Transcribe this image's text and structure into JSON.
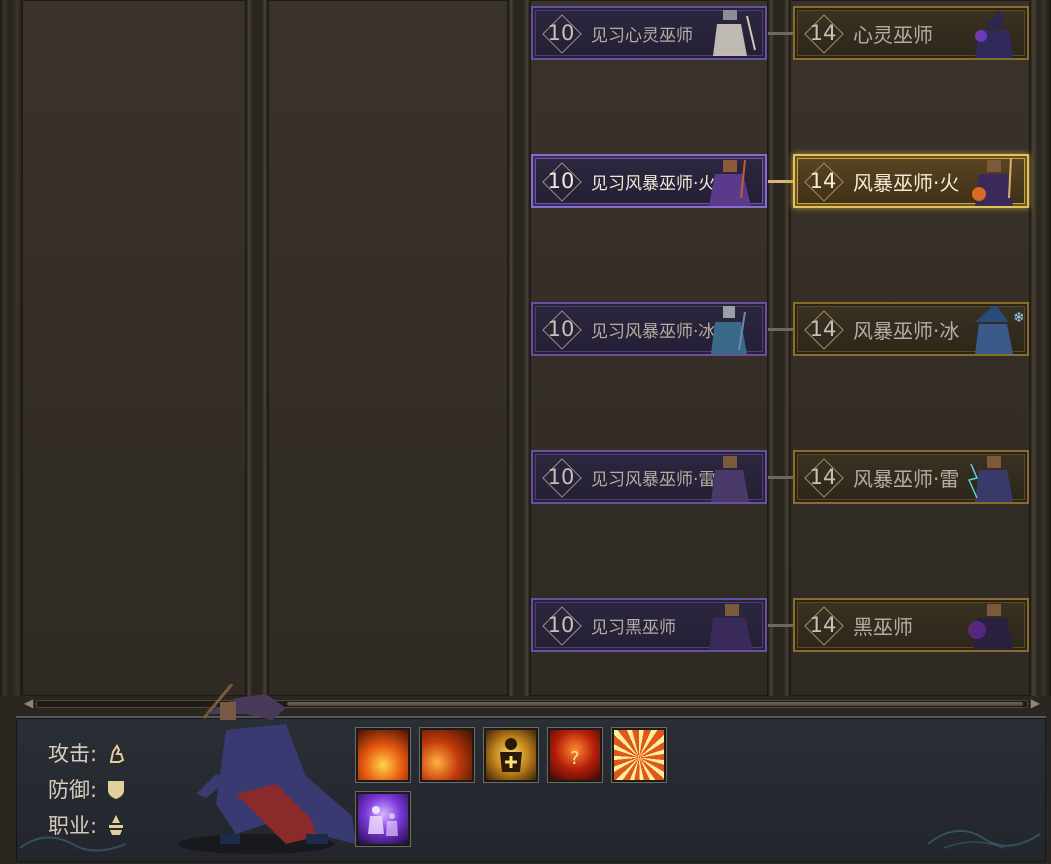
{
  "tree": {
    "rows": [
      {
        "left": {
          "level": "10",
          "name": "见习心灵巫师",
          "figure": "mind-apprentice-figure"
        },
        "right": {
          "level": "14",
          "name": "心灵巫师",
          "figure": "mind-wizard-figure"
        },
        "active": false
      },
      {
        "left": {
          "level": "10",
          "name": "见习风暴巫师·火",
          "figure": "fire-apprentice-figure"
        },
        "right": {
          "level": "14",
          "name": "风暴巫师·火",
          "figure": "fire-wizard-figure"
        },
        "active": true
      },
      {
        "left": {
          "level": "10",
          "name": "见习风暴巫师·冰",
          "figure": "ice-apprentice-figure"
        },
        "right": {
          "level": "14",
          "name": "风暴巫师·冰",
          "figure": "ice-wizard-figure"
        },
        "active": false
      },
      {
        "left": {
          "level": "10",
          "name": "见习风暴巫师·雷",
          "figure": "thunder-apprentice-figure"
        },
        "right": {
          "level": "14",
          "name": "风暴巫师·雷",
          "figure": "thunder-wizard-figure"
        },
        "active": false
      },
      {
        "left": {
          "level": "10",
          "name": "见习黑巫师",
          "figure": "dark-apprentice-figure"
        },
        "right": {
          "level": "14",
          "name": "黑巫师",
          "figure": "dark-wizard-figure"
        },
        "active": false
      }
    ]
  },
  "info": {
    "attack_label": "攻击:",
    "defense_label": "防御:",
    "class_label": "职业:",
    "attack_icon": "magic-hand-icon",
    "defense_icon": "shield-icon",
    "class_icon": "mage-icon"
  },
  "skills": [
    {
      "icon": "fire-pillar-skill-icon",
      "colors": [
        "#ffd34a",
        "#e85a10",
        "#4a1004"
      ]
    },
    {
      "icon": "meteor-skill-icon",
      "colors": [
        "#ffb040",
        "#c23a0a",
        "#3a1205"
      ]
    },
    {
      "icon": "heal-buff-skill-icon",
      "colors": [
        "#ffe070",
        "#c0801a",
        "#3a2608"
      ]
    },
    {
      "icon": "fire-rune-skill-icon",
      "colors": [
        "#ff8a30",
        "#b51e0a",
        "#3a0a05"
      ]
    },
    {
      "icon": "fire-wheel-skill-icon",
      "colors": [
        "#fff0a0",
        "#e2561a",
        "#5a1a06"
      ]
    },
    {
      "icon": "shadow-clone-skill-icon",
      "colors": [
        "#d8b4ff",
        "#7a38d8",
        "#1e0a40"
      ]
    }
  ],
  "colors": {
    "purple_frame": "#6a4fa0",
    "gold_frame": "#8a6d2c",
    "active_gold": "#e0c35a"
  }
}
